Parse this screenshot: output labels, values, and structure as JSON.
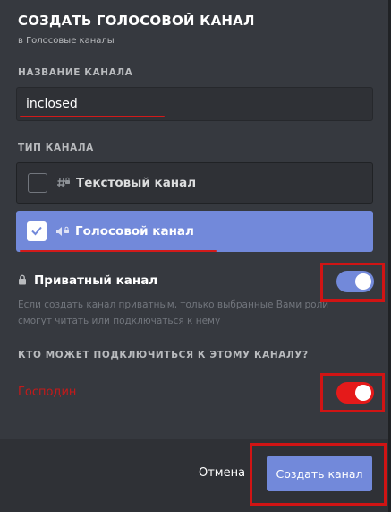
{
  "modal": {
    "title": "СОЗДАТЬ ГОЛОСОВОЙ КАНАЛ",
    "subtitle": "в Голосовые каналы"
  },
  "channel_name": {
    "label": "НАЗВАНИЕ КАНАЛА",
    "value": "inclosed"
  },
  "channel_type": {
    "label": "ТИП КАНАЛА",
    "options": [
      {
        "label": "Текстовый канал",
        "icon": "text-channel-hash-lock-icon",
        "checked": false
      },
      {
        "label": "Голосовой канал",
        "icon": "voice-speaker-lock-icon",
        "checked": true
      }
    ]
  },
  "private": {
    "label": "Приватный канал",
    "help": "Если создать канал приватным, только выбранные Вами роли смогут читать или подключаться к нему",
    "enabled": true
  },
  "access": {
    "label": "КТО МОЖЕТ ПОДКЛЮЧИТЬСЯ К ЭТОМУ КАНАЛУ?",
    "roles": [
      {
        "label": "Господин",
        "enabled": true
      }
    ]
  },
  "footer": {
    "cancel_label": "Отмена",
    "create_label": "Создать канал"
  },
  "colors": {
    "background": "#36393f",
    "accent": "#7289da",
    "annotation_red": "#d01414"
  }
}
